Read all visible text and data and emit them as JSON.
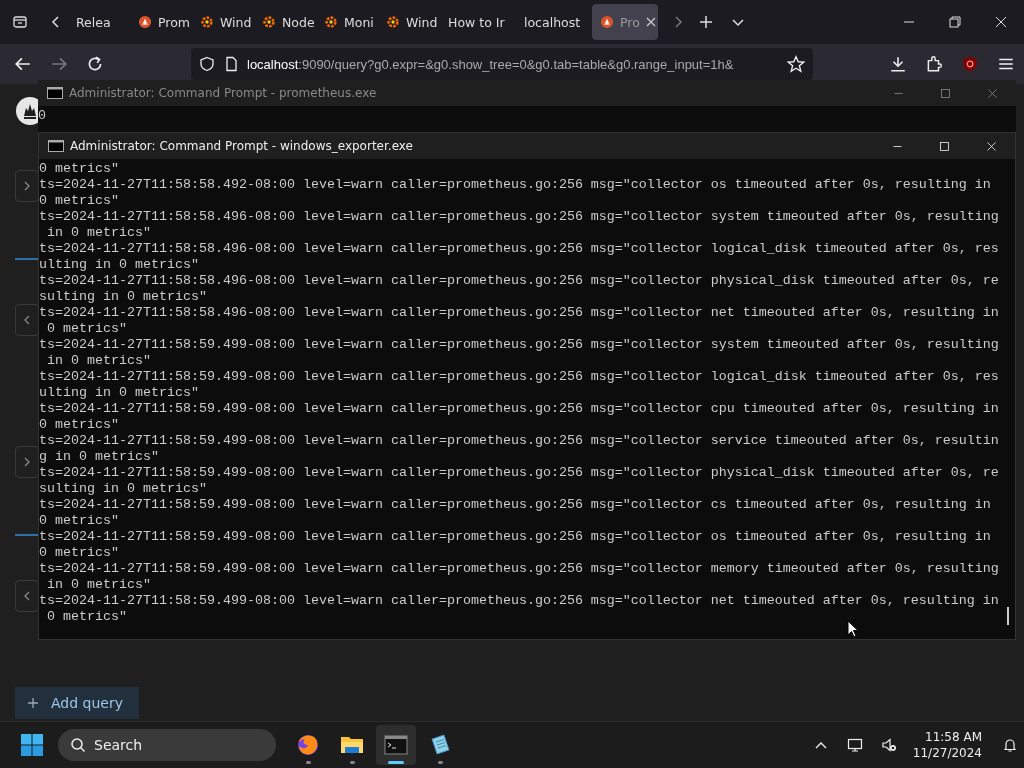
{
  "browser": {
    "tabs": [
      {
        "label": "Relea",
        "kind": "plain",
        "selected": false
      },
      {
        "label": "Prom",
        "kind": "flame",
        "selected": false
      },
      {
        "label": "Wind",
        "kind": "gear",
        "selected": false
      },
      {
        "label": "Node",
        "kind": "gear",
        "selected": false
      },
      {
        "label": "Moni",
        "kind": "gear",
        "selected": false
      },
      {
        "label": "Wind",
        "kind": "gear",
        "selected": false
      },
      {
        "label": "How to Ir",
        "kind": "plain",
        "selected": false
      },
      {
        "label": "localhost",
        "kind": "plain",
        "selected": false
      },
      {
        "label": "Pro",
        "kind": "flame",
        "selected": true
      }
    ],
    "url_host": "localhost",
    "url_path": ":9090/query?g0.expr=&g0.show_tree=0&g0.tab=table&g0.range_input=1h&"
  },
  "page": {
    "add_query": "Add query"
  },
  "windows": [
    {
      "title": "Administrator: Command Prompt - prometheus.exe",
      "active": false,
      "lines": [
        "0"
      ]
    },
    {
      "title": "Administrator: Command Prompt - windows_exporter.exe",
      "active": true,
      "lines": [
        "0 metrics\"",
        "ts=2024-11-27T11:58:58.492-08:00 level=warn caller=prometheus.go:256 msg=\"collector os timeouted after 0s, resulting in",
        "0 metrics\"",
        "ts=2024-11-27T11:58:58.496-08:00 level=warn caller=prometheus.go:256 msg=\"collector system timeouted after 0s, resulting",
        " in 0 metrics\"",
        "ts=2024-11-27T11:58:58.496-08:00 level=warn caller=prometheus.go:256 msg=\"collector logical_disk timeouted after 0s, res",
        "ulting in 0 metrics\"",
        "ts=2024-11-27T11:58:58.496-08:00 level=warn caller=prometheus.go:256 msg=\"collector physical_disk timeouted after 0s, re",
        "sulting in 0 metrics\"",
        "ts=2024-11-27T11:58:58.496-08:00 level=warn caller=prometheus.go:256 msg=\"collector net timeouted after 0s, resulting in",
        " 0 metrics\"",
        "ts=2024-11-27T11:58:59.499-08:00 level=warn caller=prometheus.go:256 msg=\"collector system timeouted after 0s, resulting",
        " in 0 metrics\"",
        "ts=2024-11-27T11:58:59.499-08:00 level=warn caller=prometheus.go:256 msg=\"collector logical_disk timeouted after 0s, res",
        "ulting in 0 metrics\"",
        "ts=2024-11-27T11:58:59.499-08:00 level=warn caller=prometheus.go:256 msg=\"collector cpu timeouted after 0s, resulting in",
        "0 metrics\"",
        "ts=2024-11-27T11:58:59.499-08:00 level=warn caller=prometheus.go:256 msg=\"collector service timeouted after 0s, resultin",
        "g in 0 metrics\"",
        "ts=2024-11-27T11:58:59.499-08:00 level=warn caller=prometheus.go:256 msg=\"collector physical_disk timeouted after 0s, re",
        "sulting in 0 metrics\"",
        "ts=2024-11-27T11:58:59.499-08:00 level=warn caller=prometheus.go:256 msg=\"collector cs timeouted after 0s, resulting in",
        "0 metrics\"",
        "ts=2024-11-27T11:58:59.499-08:00 level=warn caller=prometheus.go:256 msg=\"collector os timeouted after 0s, resulting in",
        "0 metrics\"",
        "ts=2024-11-27T11:58:59.499-08:00 level=warn caller=prometheus.go:256 msg=\"collector memory timeouted after 0s, resulting",
        " in 0 metrics\"",
        "ts=2024-11-27T11:58:59.499-08:00 level=warn caller=prometheus.go:256 msg=\"collector net timeouted after 0s, resulting in",
        " 0 metrics\""
      ]
    }
  ],
  "taskbar": {
    "search": {
      "placeholder": "Search"
    },
    "apps": [
      {
        "kind": "browser",
        "active": false
      },
      {
        "kind": "folder",
        "active": false
      },
      {
        "kind": "terminal",
        "active": true
      },
      {
        "kind": "notepad",
        "active": false
      }
    ],
    "time": "11:58 AM",
    "date": "11/27/2024"
  }
}
